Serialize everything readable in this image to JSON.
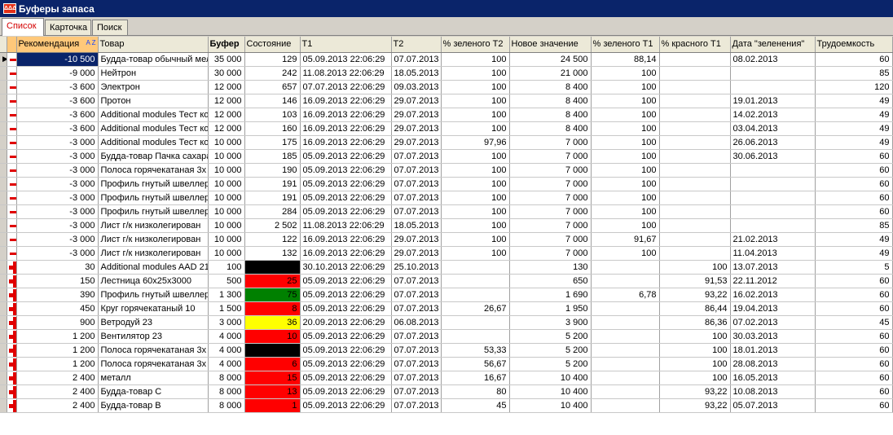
{
  "window": {
    "title": "Буферы запаса",
    "icon_label": "ΔΔΔ"
  },
  "tabs": [
    {
      "label": "Список",
      "active": true
    },
    {
      "label": "Карточка",
      "active": false
    },
    {
      "label": "Поиск",
      "active": false
    }
  ],
  "columns": [
    "Рекомендация",
    "Товар",
    "Буфер",
    "Состояние",
    "T1",
    "T2",
    "% зеленого T2",
    "Новое значение",
    "% зеленого T1",
    "% красного T1",
    "Дата \"зеленения\"",
    "Трудоемкость"
  ],
  "sort_indicator": "A Z",
  "colors": {
    "red": "#ff0000",
    "green": "#008000",
    "black": "#000000",
    "yellow": "#ffff00",
    "selection": "#0a246a"
  },
  "rows": [
    {
      "icon": "minus",
      "rec": "-10 500",
      "item": "Будда-товар обычный мел",
      "buf": "35 000",
      "state": "129",
      "color": "",
      "t1": "05.09.2013 22:06:29",
      "t2": "07.07.2013",
      "g2": "100",
      "nv": "24 500",
      "g1": "88,14",
      "r1": "",
      "date": "08.02.2013",
      "labor": "60"
    },
    {
      "icon": "minus",
      "rec": "-9 000",
      "item": "Нейтрон",
      "buf": "30 000",
      "state": "242",
      "color": "",
      "t1": "11.08.2013 22:06:29",
      "t2": "18.05.2013",
      "g2": "100",
      "nv": "21 000",
      "g1": "100",
      "r1": "",
      "date": "",
      "labor": "85"
    },
    {
      "icon": "minus",
      "rec": "-3 600",
      "item": "Электрон",
      "buf": "12 000",
      "state": "657",
      "color": "",
      "t1": "07.07.2013 22:06:29",
      "t2": "09.03.2013",
      "g2": "100",
      "nv": "8 400",
      "g1": "100",
      "r1": "",
      "date": "",
      "labor": "120"
    },
    {
      "icon": "minus",
      "rec": "-3 600",
      "item": "Протон",
      "buf": "12 000",
      "state": "146",
      "color": "",
      "t1": "16.09.2013 22:06:29",
      "t2": "29.07.2013",
      "g2": "100",
      "nv": "8 400",
      "g1": "100",
      "r1": "",
      "date": "19.01.2013",
      "labor": "49"
    },
    {
      "icon": "minus",
      "rec": "-3 600",
      "item": "Additional modules Тест ко",
      "buf": "12 000",
      "state": "103",
      "color": "",
      "t1": "16.09.2013 22:06:29",
      "t2": "29.07.2013",
      "g2": "100",
      "nv": "8 400",
      "g1": "100",
      "r1": "",
      "date": "14.02.2013",
      "labor": "49"
    },
    {
      "icon": "minus",
      "rec": "-3 600",
      "item": "Additional modules Тест ко",
      "buf": "12 000",
      "state": "160",
      "color": "",
      "t1": "16.09.2013 22:06:29",
      "t2": "29.07.2013",
      "g2": "100",
      "nv": "8 400",
      "g1": "100",
      "r1": "",
      "date": "03.04.2013",
      "labor": "49"
    },
    {
      "icon": "minus",
      "rec": "-3 000",
      "item": "Additional modules Тест ко",
      "buf": "10 000",
      "state": "175",
      "color": "",
      "t1": "16.09.2013 22:06:29",
      "t2": "29.07.2013",
      "g2": "97,96",
      "nv": "7 000",
      "g1": "100",
      "r1": "",
      "date": "26.06.2013",
      "labor": "49"
    },
    {
      "icon": "minus",
      "rec": "-3 000",
      "item": "Будда-товар Пачка сахара",
      "buf": "10 000",
      "state": "185",
      "color": "",
      "t1": "05.09.2013 22:06:29",
      "t2": "07.07.2013",
      "g2": "100",
      "nv": "7 000",
      "g1": "100",
      "r1": "",
      "date": "30.06.2013",
      "labor": "60"
    },
    {
      "icon": "minus",
      "rec": "-3 000",
      "item": "Полоса горячекатаная 3х",
      "buf": "10 000",
      "state": "190",
      "color": "",
      "t1": "05.09.2013 22:06:29",
      "t2": "07.07.2013",
      "g2": "100",
      "nv": "7 000",
      "g1": "100",
      "r1": "",
      "date": "",
      "labor": "60"
    },
    {
      "icon": "minus",
      "rec": "-3 000",
      "item": "Профиль гнутый швеллер",
      "buf": "10 000",
      "state": "191",
      "color": "",
      "t1": "05.09.2013 22:06:29",
      "t2": "07.07.2013",
      "g2": "100",
      "nv": "7 000",
      "g1": "100",
      "r1": "",
      "date": "",
      "labor": "60"
    },
    {
      "icon": "minus",
      "rec": "-3 000",
      "item": "Профиль гнутый швеллер",
      "buf": "10 000",
      "state": "191",
      "color": "",
      "t1": "05.09.2013 22:06:29",
      "t2": "07.07.2013",
      "g2": "100",
      "nv": "7 000",
      "g1": "100",
      "r1": "",
      "date": "",
      "labor": "60"
    },
    {
      "icon": "minus",
      "rec": "-3 000",
      "item": "Профиль гнутый швеллер",
      "buf": "10 000",
      "state": "284",
      "color": "",
      "t1": "05.09.2013 22:06:29",
      "t2": "07.07.2013",
      "g2": "100",
      "nv": "7 000",
      "g1": "100",
      "r1": "",
      "date": "",
      "labor": "60"
    },
    {
      "icon": "minus",
      "rec": "-3 000",
      "item": "Лист г/к низколегирован",
      "buf": "10 000",
      "state": "2 502",
      "color": "",
      "t1": "11.08.2013 22:06:29",
      "t2": "18.05.2013",
      "g2": "100",
      "nv": "7 000",
      "g1": "100",
      "r1": "",
      "date": "",
      "labor": "85"
    },
    {
      "icon": "minus",
      "rec": "-3 000",
      "item": "Лист г/к низколегирован",
      "buf": "10 000",
      "state": "122",
      "color": "",
      "t1": "16.09.2013 22:06:29",
      "t2": "29.07.2013",
      "g2": "100",
      "nv": "7 000",
      "g1": "91,67",
      "r1": "",
      "date": "21.02.2013",
      "labor": "49"
    },
    {
      "icon": "minus",
      "rec": "-3 000",
      "item": "Лист г/к низколегирован",
      "buf": "10 000",
      "state": "132",
      "color": "",
      "t1": "16.09.2013 22:06:29",
      "t2": "29.07.2013",
      "g2": "100",
      "nv": "7 000",
      "g1": "100",
      "r1": "",
      "date": "11.04.2013",
      "labor": "49"
    },
    {
      "icon": "plus",
      "rec": "30",
      "item": "Additional modules AAD 21",
      "buf": "100",
      "state": "",
      "color": "black",
      "t1": "30.10.2013 22:06:29",
      "t2": "25.10.2013",
      "g2": "",
      "nv": "130",
      "g1": "",
      "r1": "100",
      "date": "13.07.2013",
      "labor": "5"
    },
    {
      "icon": "plus",
      "rec": "150",
      "item": "Лестница 60x25x3000",
      "buf": "500",
      "state": "25",
      "color": "red",
      "t1": "05.09.2013 22:06:29",
      "t2": "07.07.2013",
      "g2": "",
      "nv": "650",
      "g1": "",
      "r1": "91,53",
      "date": "22.11.2012",
      "labor": "60"
    },
    {
      "icon": "plus",
      "rec": "390",
      "item": "Профиль гнутый швеллер",
      "buf": "1 300",
      "state": "75",
      "color": "green",
      "t1": "05.09.2013 22:06:29",
      "t2": "07.07.2013",
      "g2": "",
      "nv": "1 690",
      "g1": "6,78",
      "r1": "93,22",
      "date": "16.02.2013",
      "labor": "60"
    },
    {
      "icon": "plus",
      "rec": "450",
      "item": "Круг горячекатаный 10",
      "buf": "1 500",
      "state": "8",
      "color": "red",
      "t1": "05.09.2013 22:06:29",
      "t2": "07.07.2013",
      "g2": "26,67",
      "nv": "1 950",
      "g1": "",
      "r1": "86,44",
      "date": "19.04.2013",
      "labor": "60"
    },
    {
      "icon": "plus",
      "rec": "900",
      "item": "Ветродуй 23",
      "buf": "3 000",
      "state": "36",
      "color": "yellow",
      "t1": "20.09.2013 22:06:29",
      "t2": "06.08.2013",
      "g2": "",
      "nv": "3 900",
      "g1": "",
      "r1": "86,36",
      "date": "07.02.2013",
      "labor": "45"
    },
    {
      "icon": "plus",
      "rec": "1 200",
      "item": "Вентилятор 23",
      "buf": "4 000",
      "state": "10",
      "color": "red",
      "t1": "05.09.2013 22:06:29",
      "t2": "07.07.2013",
      "g2": "",
      "nv": "5 200",
      "g1": "",
      "r1": "100",
      "date": "30.03.2013",
      "labor": "60"
    },
    {
      "icon": "plus",
      "rec": "1 200",
      "item": "Полоса горячекатаная 3х",
      "buf": "4 000",
      "state": "",
      "color": "black",
      "t1": "05.09.2013 22:06:29",
      "t2": "07.07.2013",
      "g2": "53,33",
      "nv": "5 200",
      "g1": "",
      "r1": "100",
      "date": "18.01.2013",
      "labor": "60"
    },
    {
      "icon": "plus",
      "rec": "1 200",
      "item": "Полоса горячекатаная 3х",
      "buf": "4 000",
      "state": "6",
      "color": "red",
      "t1": "05.09.2013 22:06:29",
      "t2": "07.07.2013",
      "g2": "56,67",
      "nv": "5 200",
      "g1": "",
      "r1": "100",
      "date": "28.08.2013",
      "labor": "60"
    },
    {
      "icon": "plus",
      "rec": "2 400",
      "item": "металл",
      "buf": "8 000",
      "state": "15",
      "color": "red",
      "t1": "05.09.2013 22:06:29",
      "t2": "07.07.2013",
      "g2": "16,67",
      "nv": "10 400",
      "g1": "",
      "r1": "100",
      "date": "16.05.2013",
      "labor": "60"
    },
    {
      "icon": "plus",
      "rec": "2 400",
      "item": "Будда-товар С",
      "buf": "8 000",
      "state": "13",
      "color": "red",
      "t1": "05.09.2013 22:06:29",
      "t2": "07.07.2013",
      "g2": "80",
      "nv": "10 400",
      "g1": "",
      "r1": "93,22",
      "date": "10.08.2013",
      "labor": "60"
    },
    {
      "icon": "plus",
      "rec": "2 400",
      "item": "Будда-товар В",
      "buf": "8 000",
      "state": "1",
      "color": "red",
      "t1": "05.09.2013 22:06:29",
      "t2": "07.07.2013",
      "g2": "45",
      "nv": "10 400",
      "g1": "",
      "r1": "93,22",
      "date": "05.07.2013",
      "labor": "60"
    }
  ]
}
